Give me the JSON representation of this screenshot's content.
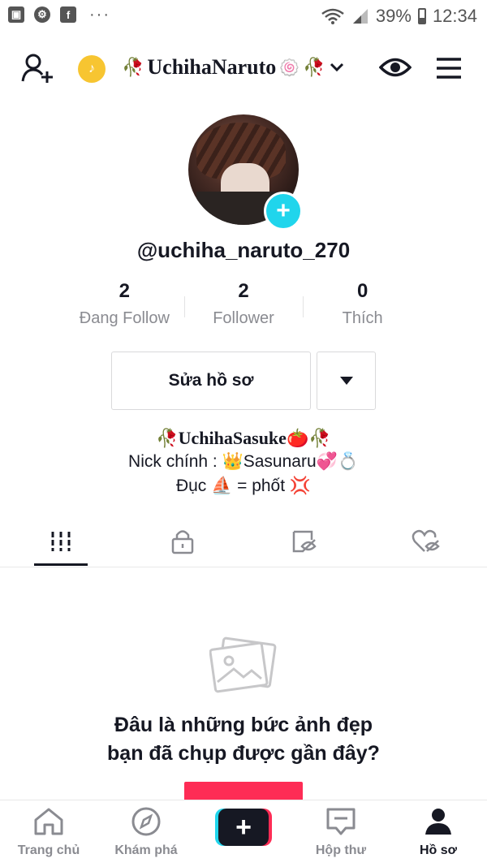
{
  "status_bar": {
    "battery": "39%",
    "time": "12:34",
    "left_icons": [
      "gallery-icon",
      "settings-icon",
      "facebook-icon"
    ],
    "more": "···"
  },
  "header": {
    "display_name": "UchihaNaruto",
    "icons": [
      "add-user-icon",
      "coin-icon",
      "eye-icon",
      "menu-icon"
    ]
  },
  "profile": {
    "username": "@uchiha_naruto_270",
    "stats": [
      {
        "value": "2",
        "label": "Đang Follow"
      },
      {
        "value": "2",
        "label": "Follower"
      },
      {
        "value": "0",
        "label": "Thích"
      }
    ],
    "edit_label": "Sửa hồ sơ",
    "bio": {
      "line1": "UchihaSasuke",
      "line2": "Nick chính : 👑Sasunaru💞💍",
      "line3": "Đục ⛵ = phốt 💢"
    }
  },
  "tabs": [
    "videos-tab",
    "private-tab",
    "hidden-tab",
    "liked-tab"
  ],
  "empty_state": {
    "title_line1": "Đâu là những bức ảnh đẹp",
    "title_line2": "bạn đã chụp được gần đây?"
  },
  "bottom_nav": [
    {
      "label": "Trang chủ",
      "icon": "home-icon"
    },
    {
      "label": "Khám phá",
      "icon": "compass-icon"
    },
    {
      "label": "",
      "icon": "plus-icon"
    },
    {
      "label": "Hộp thư",
      "icon": "inbox-icon"
    },
    {
      "label": "Hồ sơ",
      "icon": "profile-icon"
    }
  ],
  "colors": {
    "accent": "#fe2c55",
    "cyan": "#20d5ec",
    "text": "#161823",
    "muted": "#8a8b91"
  }
}
